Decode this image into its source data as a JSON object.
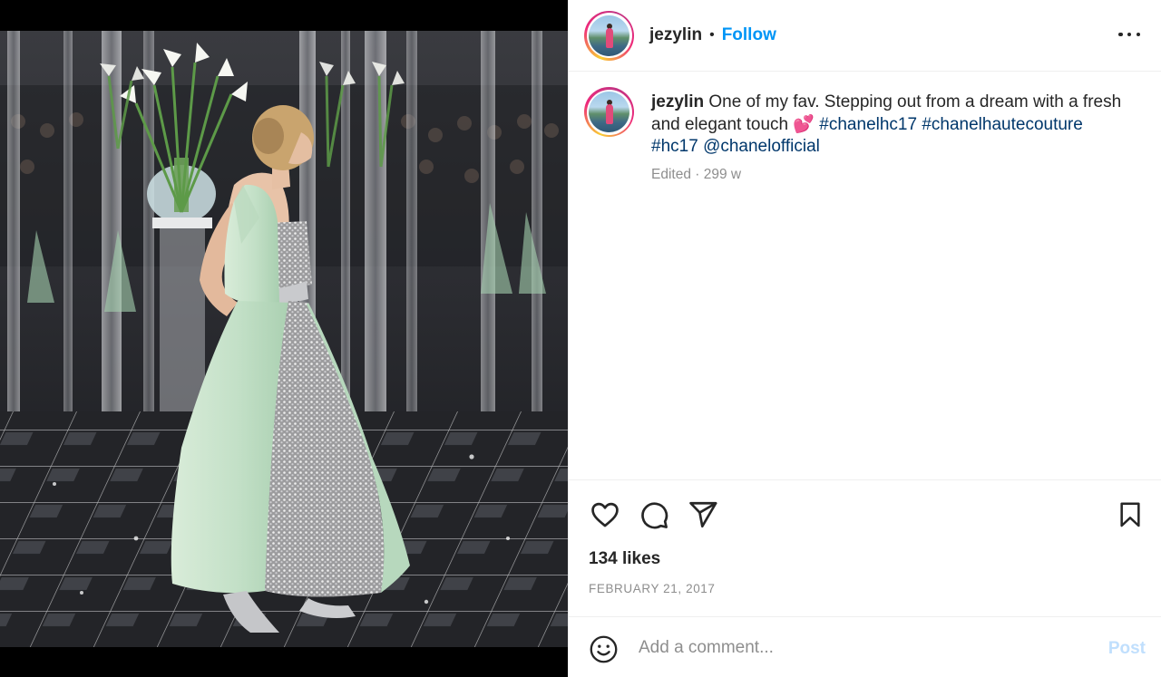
{
  "post": {
    "username": "jezylin",
    "follow_label": "Follow",
    "separator": "•",
    "caption": {
      "username": "jezylin",
      "text": "One of my fav. Stepping out from a dream with a fresh and elegant touch 💕",
      "hashtags": [
        "#chanelhc17",
        "#chanelhautecouture",
        "#hc17"
      ],
      "mention": "@chanelofficial"
    },
    "meta": "Edited · 299 w",
    "likes": "134 likes",
    "date": "FEBRUARY 21, 2017"
  },
  "comment_box": {
    "placeholder": "Add a comment...",
    "post_label": "Post"
  },
  "icons": {
    "like": "heart-icon",
    "comment": "comment-bubble-icon",
    "share": "paper-plane-icon",
    "save": "bookmark-icon",
    "emoji": "smiley-icon",
    "more": "more-options-icon"
  },
  "colors": {
    "accent": "#0095f6",
    "hashtag": "#00376b",
    "muted": "#8e8e8e",
    "post_disabled": "#c0dffd",
    "text": "#262626"
  }
}
